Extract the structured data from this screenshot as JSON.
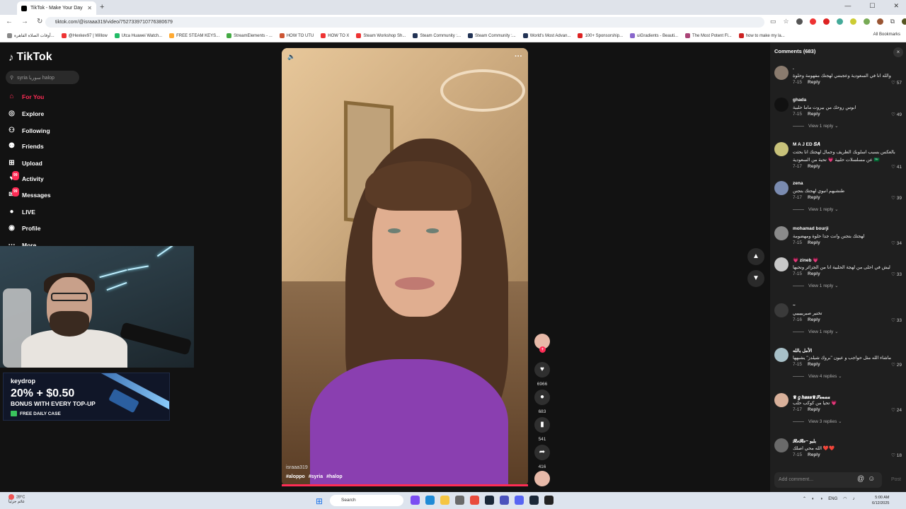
{
  "browser": {
    "tab_title": "TikTok - Make Your Day",
    "new_tab": "+",
    "url": "tiktok.com/@israaa319/video/7527339710776380679",
    "bookmarks": [
      "أوقات الصلاة القاهرة...",
      "@Hexkev97 | Willow",
      "Utca Huawei Watch...",
      "FREE STEAM KEYS...",
      "StreamElements - ...",
      "HOW TO UTU",
      "HOW TO X",
      "Steam Workshop Sh...",
      "Steam Community :...",
      "Steam Community :...",
      "World's Most Advan...",
      "100+ Sponsorship...",
      "uiGradients - Beauti...",
      "The Most Potent Fl...",
      "how to make my la..."
    ],
    "all_bookmarks": "All Bookmarks"
  },
  "sidebar": {
    "logo": "TikTok",
    "search_placeholder": "syria سوريا halop",
    "items": [
      {
        "label": "For You",
        "icon": "home-icon"
      },
      {
        "label": "Explore",
        "icon": "compass-icon"
      },
      {
        "label": "Following",
        "icon": "following-icon"
      },
      {
        "label": "Friends",
        "icon": "friends-icon"
      },
      {
        "label": "Upload",
        "icon": "upload-icon"
      },
      {
        "label": "Activity",
        "icon": "activity-icon",
        "badge": "99"
      },
      {
        "label": "Messages",
        "icon": "messages-icon",
        "badge": "99"
      },
      {
        "label": "LIVE",
        "icon": "live-icon"
      },
      {
        "label": "Profile",
        "icon": "profile-icon"
      },
      {
        "label": "More",
        "icon": "more-icon"
      }
    ]
  },
  "ad": {
    "brand": "keydrop",
    "promo": "20% + $0.50",
    "sub": "BONUS WITH EVERY TOP-UP",
    "cta": "FREE DAILY CASE"
  },
  "video": {
    "author": "israaa319",
    "tags": [
      "#aloppo",
      "#syria",
      "#halop"
    ],
    "more": "···",
    "likes": "6966",
    "comments": "683",
    "saves": "541",
    "shares": "416"
  },
  "comments_panel": {
    "title": "Comments (683)",
    "close": "×",
    "input_placeholder": "Add comment...",
    "post": "Post",
    "items": [
      {
        "name": ".",
        "text": "والله انا في السعودية وعجبتني لهجتك مفهومة وحلوة",
        "date": "7-15",
        "likes": "57",
        "reply": "Reply",
        "replies": ""
      },
      {
        "name": "ghada",
        "text": "ابوس روحك من بيروت ماما حلبية",
        "date": "7-15",
        "likes": "49",
        "reply": "Reply",
        "replies": "View 1 reply"
      },
      {
        "name": "M A J ED 𝑺𝑨",
        "text": "بالعكس بسبب اسلوبك الظريف وجمال لهجتك انا بحثت",
        "text2": "عن مسلسلات حلبية 💗 تحية من السعودية 🇸🇦",
        "date": "7-17",
        "likes": "41",
        "reply": "Reply",
        "replies": ""
      },
      {
        "name": "zena",
        "text": "طنشيهم انبوي لهجتك بتجنن",
        "date": "7-17",
        "likes": "39",
        "reply": "Reply",
        "replies": "View 1 reply"
      },
      {
        "name": "mohamad bourji",
        "text": "لهجتك بتجنن وانت جدا حلوة ومهضومة",
        "date": "7-15",
        "likes": "34",
        "reply": "Reply",
        "replies": ""
      },
      {
        "name": "💗 zineb 💗",
        "text": "ليش في احلى من لهجة الحلبية انا من الجزائر ونحبها",
        "date": "7-15",
        "likes": "33",
        "reply": "Reply",
        "replies": "View 1 reply"
      },
      {
        "name": "~",
        "text": "تختير صبريييييي",
        "date": "7-16",
        "likes": "33",
        "reply": "Reply",
        "replies": "View 1 reply"
      },
      {
        "name": "الأمل بالله",
        "text": "ماشاء الله مثل حواجب و عيون \"بروك شيلدز\" يشبهها",
        "date": "7-15",
        "likes": "29",
        "reply": "Reply",
        "replies": "View 4 replies"
      },
      {
        "name": "♛ℊ𝒉𝒂𝒔𝒔♛𝓢𝓮𝓷𝓪𝓪",
        "text": "تحيا من كوكب حلب 💗",
        "date": "7-17",
        "likes": "24",
        "reply": "Reply",
        "replies": "View 3 replies"
      },
      {
        "name": "𝓡𝓸𝓡𝓸~ بلبو",
        "text": "الله محي اصلك ❤️❤️",
        "date": "7-15",
        "likes": "18",
        "reply": "Reply",
        "replies": ""
      }
    ]
  },
  "taskbar": {
    "weather_temp": "28°C",
    "weather_desc": "غائم جزئياً",
    "search": "Search",
    "lang": "ENG",
    "time": "5:00 AM",
    "date": "6/12/2025"
  }
}
